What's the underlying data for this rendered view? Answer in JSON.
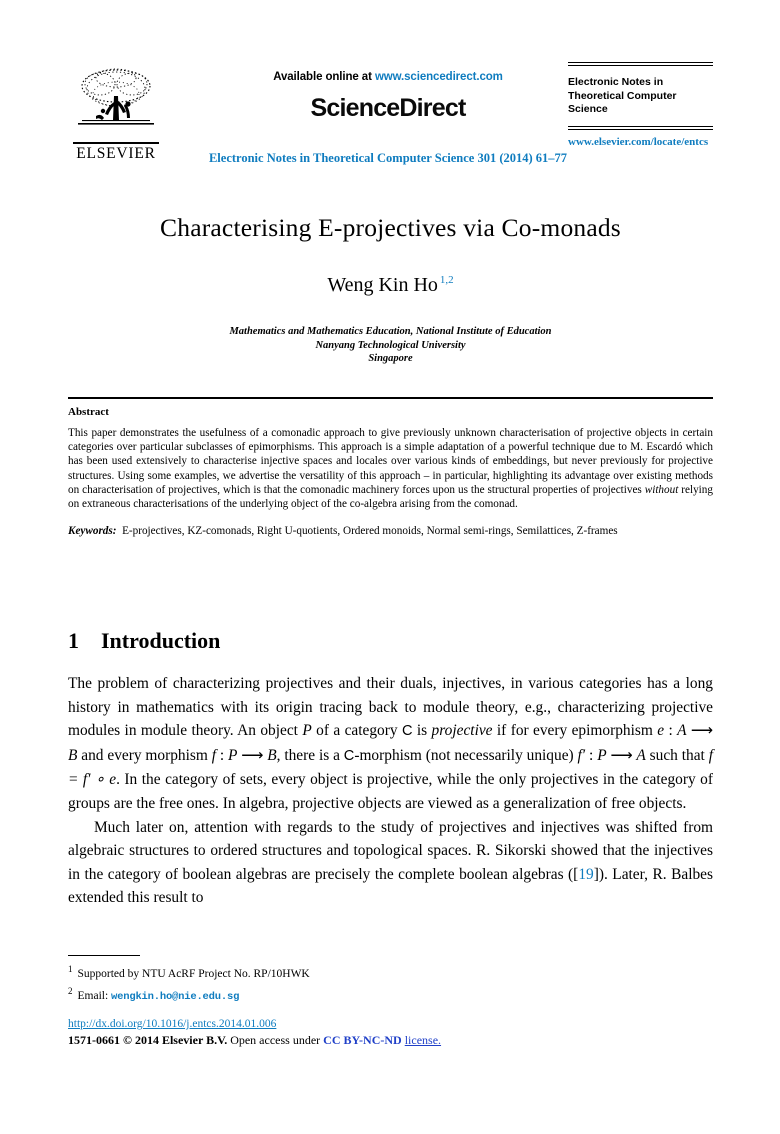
{
  "masthead": {
    "publisher": "ELSEVIER",
    "available_online_prefix": "Available online at ",
    "sciencedirect_url": "www.sciencedirect.com",
    "sciencedirect_wordmark": "ScienceDirect",
    "journal_reference": "Electronic Notes in Theoretical Computer Science 301 (2014) 61–77",
    "journal_name": "Electronic Notes in Theoretical Computer Science",
    "elsevier_locate_url": "www.elsevier.com/locate/entcs"
  },
  "paper": {
    "title": "Characterising E-projectives via Co-monads",
    "author": "Weng Kin Ho",
    "author_footnote_marks": "1,2",
    "affiliation_line1": "Mathematics and Mathematics Education, National Institute of Education",
    "affiliation_line2": "Nanyang Technological University",
    "affiliation_line3": "Singapore"
  },
  "abstract": {
    "heading": "Abstract",
    "text_part1": "This paper demonstrates the usefulness of a comonadic approach to give previously unknown characterisation of projective objects in certain categories over particular subclasses of epimorphisms. This approach is a simple adaptation of a powerful technique due to M. Escardó which has been used extensively to characterise injective spaces and locales over various kinds of embeddings, but never previously for projective structures. Using some examples, we advertise the versatility of this approach – in particular, highlighting its advantage over existing methods on characterisation of projectives, which is that the comonadic machinery forces upon us the structural properties of projectives ",
    "text_italic": "without",
    "text_part2": " relying on extraneous characterisations of the underlying object of the co-algebra arising from the comonad.",
    "keywords_label": "Keywords:",
    "keywords_value": "E-projectives, KZ-comonads, Right U-quotients, Ordered monoids, Normal semi-rings, Semilattices, Z-frames"
  },
  "section": {
    "number": "1",
    "title": "Introduction"
  },
  "body": {
    "p1_a": "The problem of characterizing projectives and their duals, injectives, in various categories has a long history in mathematics with its origin tracing back to module theory, e.g., characterizing projective modules in module theory. An object ",
    "p1_P1": "P",
    "p1_b": " of a category ",
    "p1_C1": "C",
    "p1_c": " is ",
    "p1_proj_it": "projective",
    "p1_d": " if for every epimorphism ",
    "p1_e": "e",
    "p1_colon1": " : ",
    "p1_A1": "A",
    "p1_arrow1": " ⟶ ",
    "p1_B1": "B",
    "p1_f": " and every morphism ",
    "p1_f2": "f",
    "p1_colon2": " : ",
    "p1_P2": "P",
    "p1_arrow2": " ⟶ ",
    "p1_B2": "B",
    "p1_g": ", there is a ",
    "p1_C2": "C",
    "p1_h": "-morphism (not necessarily unique) ",
    "p1_fprime": "f′",
    "p1_colon3": " : ",
    "p1_P3": "P",
    "p1_arrow3": " ⟶ ",
    "p1_A2": "A",
    "p1_i": " such that ",
    "p1_eq": "f = f′ ∘ e",
    "p1_j": ". In the category of sets, every object is projective, while the only projectives in the category of groups are the free ones. In algebra, projective objects are viewed as a generalization of free objects.",
    "p2_a": "Much later on, attention with regards to the study of projectives and injectives was shifted from algebraic structures to ordered structures and topological spaces. R. Sikorski showed that the injectives in the category of boolean algebras are precisely the complete boolean algebras ([",
    "p2_cite": "19",
    "p2_b": "]). Later, R. Balbes extended this result to"
  },
  "footnotes": {
    "fn1_num": "1",
    "fn1_text": "Supported by NTU AcRF Project No. RP/10HWK",
    "fn2_num": "2",
    "fn2_label": "Email:",
    "fn2_email": "wengkin.ho@nie.edu.sg"
  },
  "footer": {
    "doi_url": "http://dx.doi.org/10.1016/j.entcs.2014.01.006",
    "issn_copyright": "1571-0661 © 2014 Elsevier B.V.",
    "open_access": "Open access under",
    "cc_label": "CC BY-NC-ND",
    "license_word": "license."
  },
  "colors": {
    "link_blue": "#0f7cbf",
    "license_blue": "#2040c8",
    "text_black": "#000000",
    "page_background": "#ffffff"
  }
}
